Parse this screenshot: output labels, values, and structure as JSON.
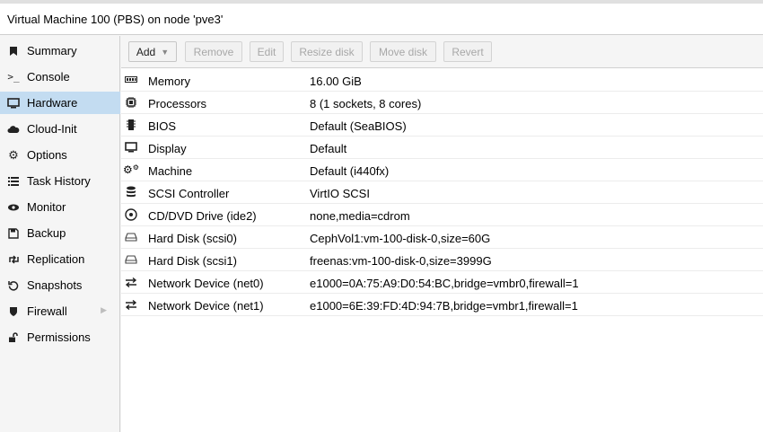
{
  "window": {
    "title": "Virtual Machine 100 (PBS) on node 'pve3'"
  },
  "sidebar": {
    "items": [
      {
        "label": "Summary",
        "icon": "summary-icon",
        "glyph": "🔖"
      },
      {
        "label": "Console",
        "icon": "console-icon",
        "glyph": ">_"
      },
      {
        "label": "Hardware",
        "icon": "monitor-icon",
        "glyph": "🖥"
      },
      {
        "label": "Cloud-Init",
        "icon": "cloud-icon",
        "glyph": "☁"
      },
      {
        "label": "Options",
        "icon": "gear-icon",
        "glyph": "⚙"
      },
      {
        "label": "Task History",
        "icon": "list-icon",
        "glyph": "☰"
      },
      {
        "label": "Monitor",
        "icon": "eye-icon",
        "glyph": "👁"
      },
      {
        "label": "Backup",
        "icon": "floppy-icon",
        "glyph": "💾"
      },
      {
        "label": "Replication",
        "icon": "retweet-icon",
        "glyph": "⇄"
      },
      {
        "label": "Snapshots",
        "icon": "history-icon",
        "glyph": "↺"
      },
      {
        "label": "Firewall",
        "icon": "shield-icon",
        "glyph": "■"
      },
      {
        "label": "Permissions",
        "icon": "unlock-icon",
        "glyph": "🔓"
      }
    ],
    "active_index": 2
  },
  "toolbar": {
    "add_label": "Add",
    "remove_label": "Remove",
    "edit_label": "Edit",
    "resize_label": "Resize disk",
    "move_label": "Move disk",
    "revert_label": "Revert"
  },
  "hardware": [
    {
      "name": "Memory",
      "value": "16.00 GiB",
      "icon": "memory-icon"
    },
    {
      "name": "Processors",
      "value": "8 (1 sockets, 8 cores)",
      "icon": "cpu-icon"
    },
    {
      "name": "BIOS",
      "value": "Default (SeaBIOS)",
      "icon": "chip-icon"
    },
    {
      "name": "Display",
      "value": "Default",
      "icon": "desktop-icon"
    },
    {
      "name": "Machine",
      "value": "Default (i440fx)",
      "icon": "cogs-icon"
    },
    {
      "name": "SCSI Controller",
      "value": "VirtIO SCSI",
      "icon": "database-icon"
    },
    {
      "name": "CD/DVD Drive (ide2)",
      "value": "none,media=cdrom",
      "icon": "cdrom-icon"
    },
    {
      "name": "Hard Disk (scsi0)",
      "value": "CephVol1:vm-100-disk-0,size=60G",
      "icon": "hdd-icon"
    },
    {
      "name": "Hard Disk (scsi1)",
      "value": "freenas:vm-100-disk-0,size=3999G",
      "icon": "hdd-icon"
    },
    {
      "name": "Network Device (net0)",
      "value": "e1000=0A:75:A9:D0:54:BC,bridge=vmbr0,firewall=1",
      "icon": "exchange-icon"
    },
    {
      "name": "Network Device (net1)",
      "value": "e1000=6E:39:FD:4D:94:7B,bridge=vmbr1,firewall=1",
      "icon": "exchange-icon"
    }
  ],
  "colors": {
    "active_nav": "#c3dcf1",
    "toolbar_bg": "#f5f5f5"
  }
}
